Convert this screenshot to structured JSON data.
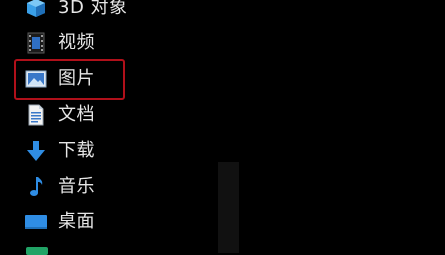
{
  "nav": {
    "items": [
      {
        "label": "3D 对象",
        "icon": "3d-objects-icon"
      },
      {
        "label": "视频",
        "icon": "videos-icon"
      },
      {
        "label": "图片",
        "icon": "pictures-icon",
        "highlighted": true
      },
      {
        "label": "文档",
        "icon": "documents-icon"
      },
      {
        "label": "下载",
        "icon": "downloads-icon"
      },
      {
        "label": "音乐",
        "icon": "music-icon"
      },
      {
        "label": "桌面",
        "icon": "desktop-icon"
      }
    ]
  },
  "colors": {
    "background": "#000000",
    "text": "#e6e6e6",
    "highlight_border": "#b0101a",
    "accent_blue": "#2f8de4"
  }
}
